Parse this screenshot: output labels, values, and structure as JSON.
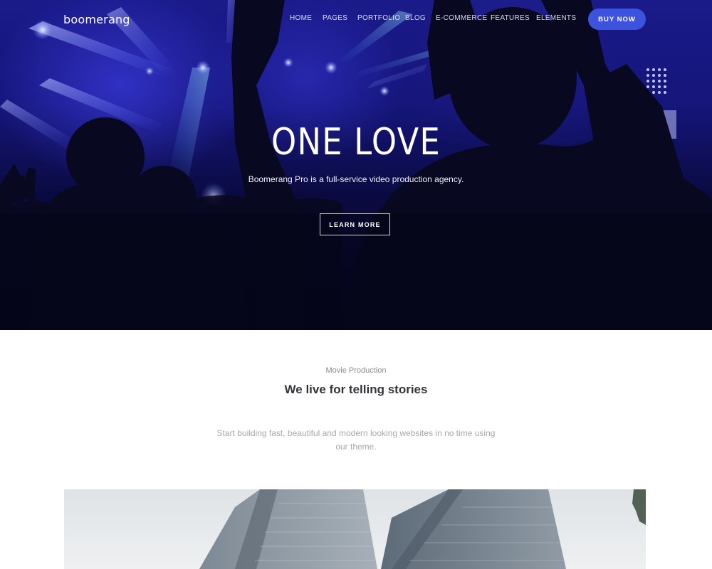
{
  "brand": {
    "logo_text": "boomerang"
  },
  "nav": {
    "items": [
      {
        "label": "HOME"
      },
      {
        "label": "PAGES"
      },
      {
        "label": "PORTFOLIO"
      },
      {
        "label": "BLOG"
      },
      {
        "label": "E-COMMERCE"
      },
      {
        "label": "FEATURES"
      },
      {
        "label": "ELEMENTS"
      }
    ],
    "cta_label": "BUY NOW"
  },
  "hero": {
    "title": "ONE LOVE",
    "subtitle": "Boomerang Pro is a full-service video production agency.",
    "button_label": "LEARN MORE"
  },
  "intro": {
    "eyebrow": "Movie Production",
    "title": "We live for telling stories",
    "description": "Start building fast, beautiful and modern looking websites in no time using our theme."
  },
  "colors": {
    "accent": "#3d53de",
    "hero_dark": "#05051c",
    "hero_blue": "#1a1a8a",
    "heading": "#33343a",
    "muted": "#a7a7ae"
  },
  "icons": {
    "background_image": "concert-crowd-photo",
    "section_image": "office-buildings-photo"
  }
}
